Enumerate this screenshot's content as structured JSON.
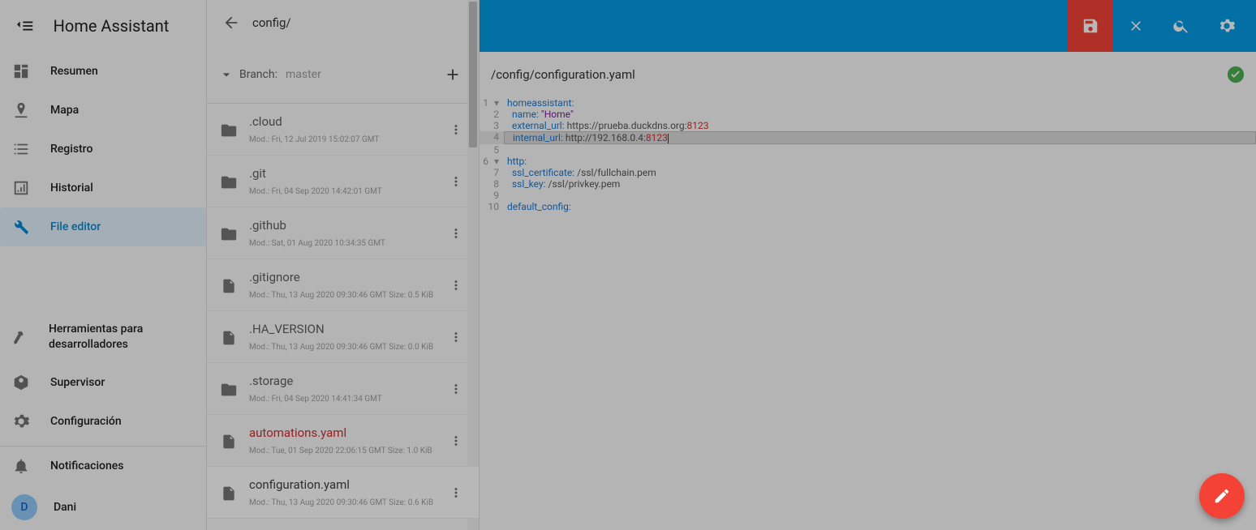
{
  "app": {
    "title": "Home Assistant"
  },
  "sidebar": {
    "items": [
      {
        "label": "Resumen"
      },
      {
        "label": "Mapa"
      },
      {
        "label": "Registro"
      },
      {
        "label": "Historial"
      },
      {
        "label": "File editor"
      },
      {
        "label": "Herramientas para desarrolladores"
      },
      {
        "label": "Supervisor"
      },
      {
        "label": "Configuración"
      }
    ],
    "notifications": "Notificaciones",
    "profile": {
      "initial": "D",
      "name": "Dani"
    }
  },
  "filePanel": {
    "path": "config/",
    "branchLabel": "Branch:",
    "branchName": "master",
    "items": [
      {
        "type": "folder",
        "name": ".cloud",
        "meta": "Mod.: Fri, 12 Jul 2019 15:02:07 GMT"
      },
      {
        "type": "folder",
        "name": ".git",
        "meta": "Mod.: Fri, 04 Sep 2020 14:42:01 GMT"
      },
      {
        "type": "folder",
        "name": ".github",
        "meta": "Mod.: Sat, 01 Aug 2020 10:34:35 GMT"
      },
      {
        "type": "file",
        "name": ".gitignore",
        "meta": "Mod.: Thu, 13 Aug 2020 09:30:46 GMT   Size: 0.5 KiB"
      },
      {
        "type": "file",
        "name": ".HA_VERSION",
        "meta": "Mod.: Thu, 13 Aug 2020 09:30:46 GMT   Size: 0.0 KiB"
      },
      {
        "type": "folder",
        "name": ".storage",
        "meta": "Mod.: Fri, 04 Sep 2020 14:41:34 GMT"
      },
      {
        "type": "file",
        "name": "automations.yaml",
        "meta": "Mod.: Tue, 01 Sep 2020 22:06:15 GMT   Size: 1.0 KiB",
        "highlight": true
      },
      {
        "type": "file",
        "name": "configuration.yaml",
        "meta": "Mod.: Thu, 13 Aug 2020 09:30:46 GMT   Size: 0.6 KiB",
        "selected": true
      }
    ]
  },
  "editor": {
    "title": "/config/configuration.yaml",
    "code": {
      "l1": {
        "key": "homeassistant",
        "colon": ":"
      },
      "l2": {
        "key": "name",
        "colon": ": ",
        "val": "\"Home\""
      },
      "l3": {
        "key": "external_url",
        "colon": ": ",
        "val": "https://prueba.duckdns.org:",
        "port": "8123"
      },
      "l4": {
        "key": "internal_url",
        "colon": ": ",
        "val": "http://192.168.0.4:",
        "port": "8123"
      },
      "l6": {
        "key": "http",
        "colon": ":"
      },
      "l7": {
        "key": "ssl_certificate",
        "colon": ": ",
        "val": "/ssl/fullchain.pem"
      },
      "l8": {
        "key": "ssl_key",
        "colon": ": ",
        "val": "/ssl/privkey.pem"
      },
      "l10": {
        "key": "default_config",
        "colon": ":"
      }
    },
    "lineNumbers": [
      "1",
      "2",
      "3",
      "4",
      "5",
      "6",
      "7",
      "8",
      "9",
      "10"
    ]
  }
}
